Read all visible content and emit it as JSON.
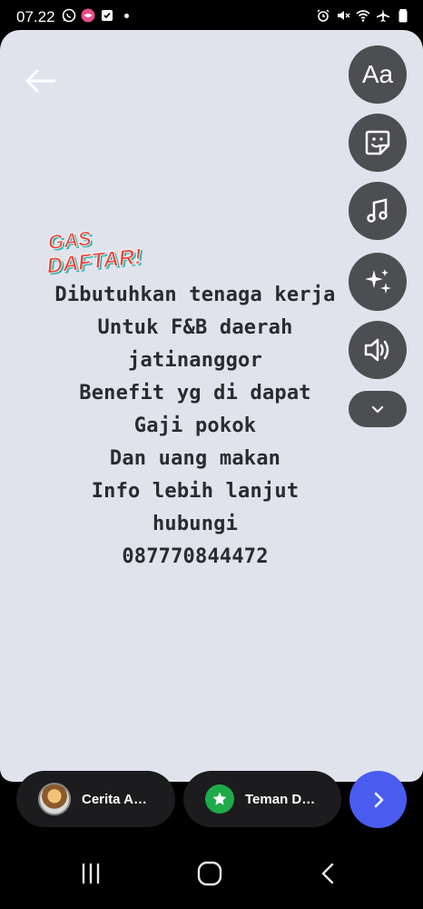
{
  "status_bar": {
    "time": "07.22",
    "left_icons": [
      "whatsapp-icon",
      "lips-app-icon",
      "checkbox-app-icon",
      "dot-icon"
    ],
    "right_icons": [
      "alarm-icon",
      "mute-icon",
      "wifi-icon",
      "airplane-icon",
      "battery-icon"
    ]
  },
  "story": {
    "back_icon": "back-arrow-icon",
    "tools": [
      {
        "name": "text-tool",
        "label": "Aa"
      },
      {
        "name": "sticker-tool",
        "icon": "sticker-icon"
      },
      {
        "name": "music-tool",
        "icon": "music-note-icon"
      },
      {
        "name": "effects-tool",
        "icon": "sparkles-icon"
      },
      {
        "name": "sound-tool",
        "icon": "speaker-icon"
      },
      {
        "name": "more-tools",
        "icon": "chevron-down-icon"
      }
    ],
    "sticker": {
      "line1": "GAS",
      "line2": "DAFTAR!"
    },
    "text_lines": [
      "Dibutuhkan tenaga kerja",
      "Untuk F&B daerah",
      "jatinanggor",
      "Benefit yg di dapat",
      "Gaji pokok",
      "Dan uang makan",
      "Info lebih lanjut",
      "hubungi",
      "087770844472"
    ]
  },
  "audience": {
    "your_story_label": "Cerita A…",
    "close_friends_label": "Teman D…",
    "send_icon": "chevron-right-icon"
  },
  "nav": {
    "recents_icon": "recents-icon",
    "home_icon": "home-icon",
    "back_icon": "back-icon"
  },
  "colors": {
    "canvas": "#e0e3ec",
    "tool_button": "#4d4e51",
    "send_button": "#4a5cf0",
    "close_friends_badge": "#1faa4a",
    "sticker_red": "#e8453c",
    "sticker_teal": "#3bb3b0"
  }
}
